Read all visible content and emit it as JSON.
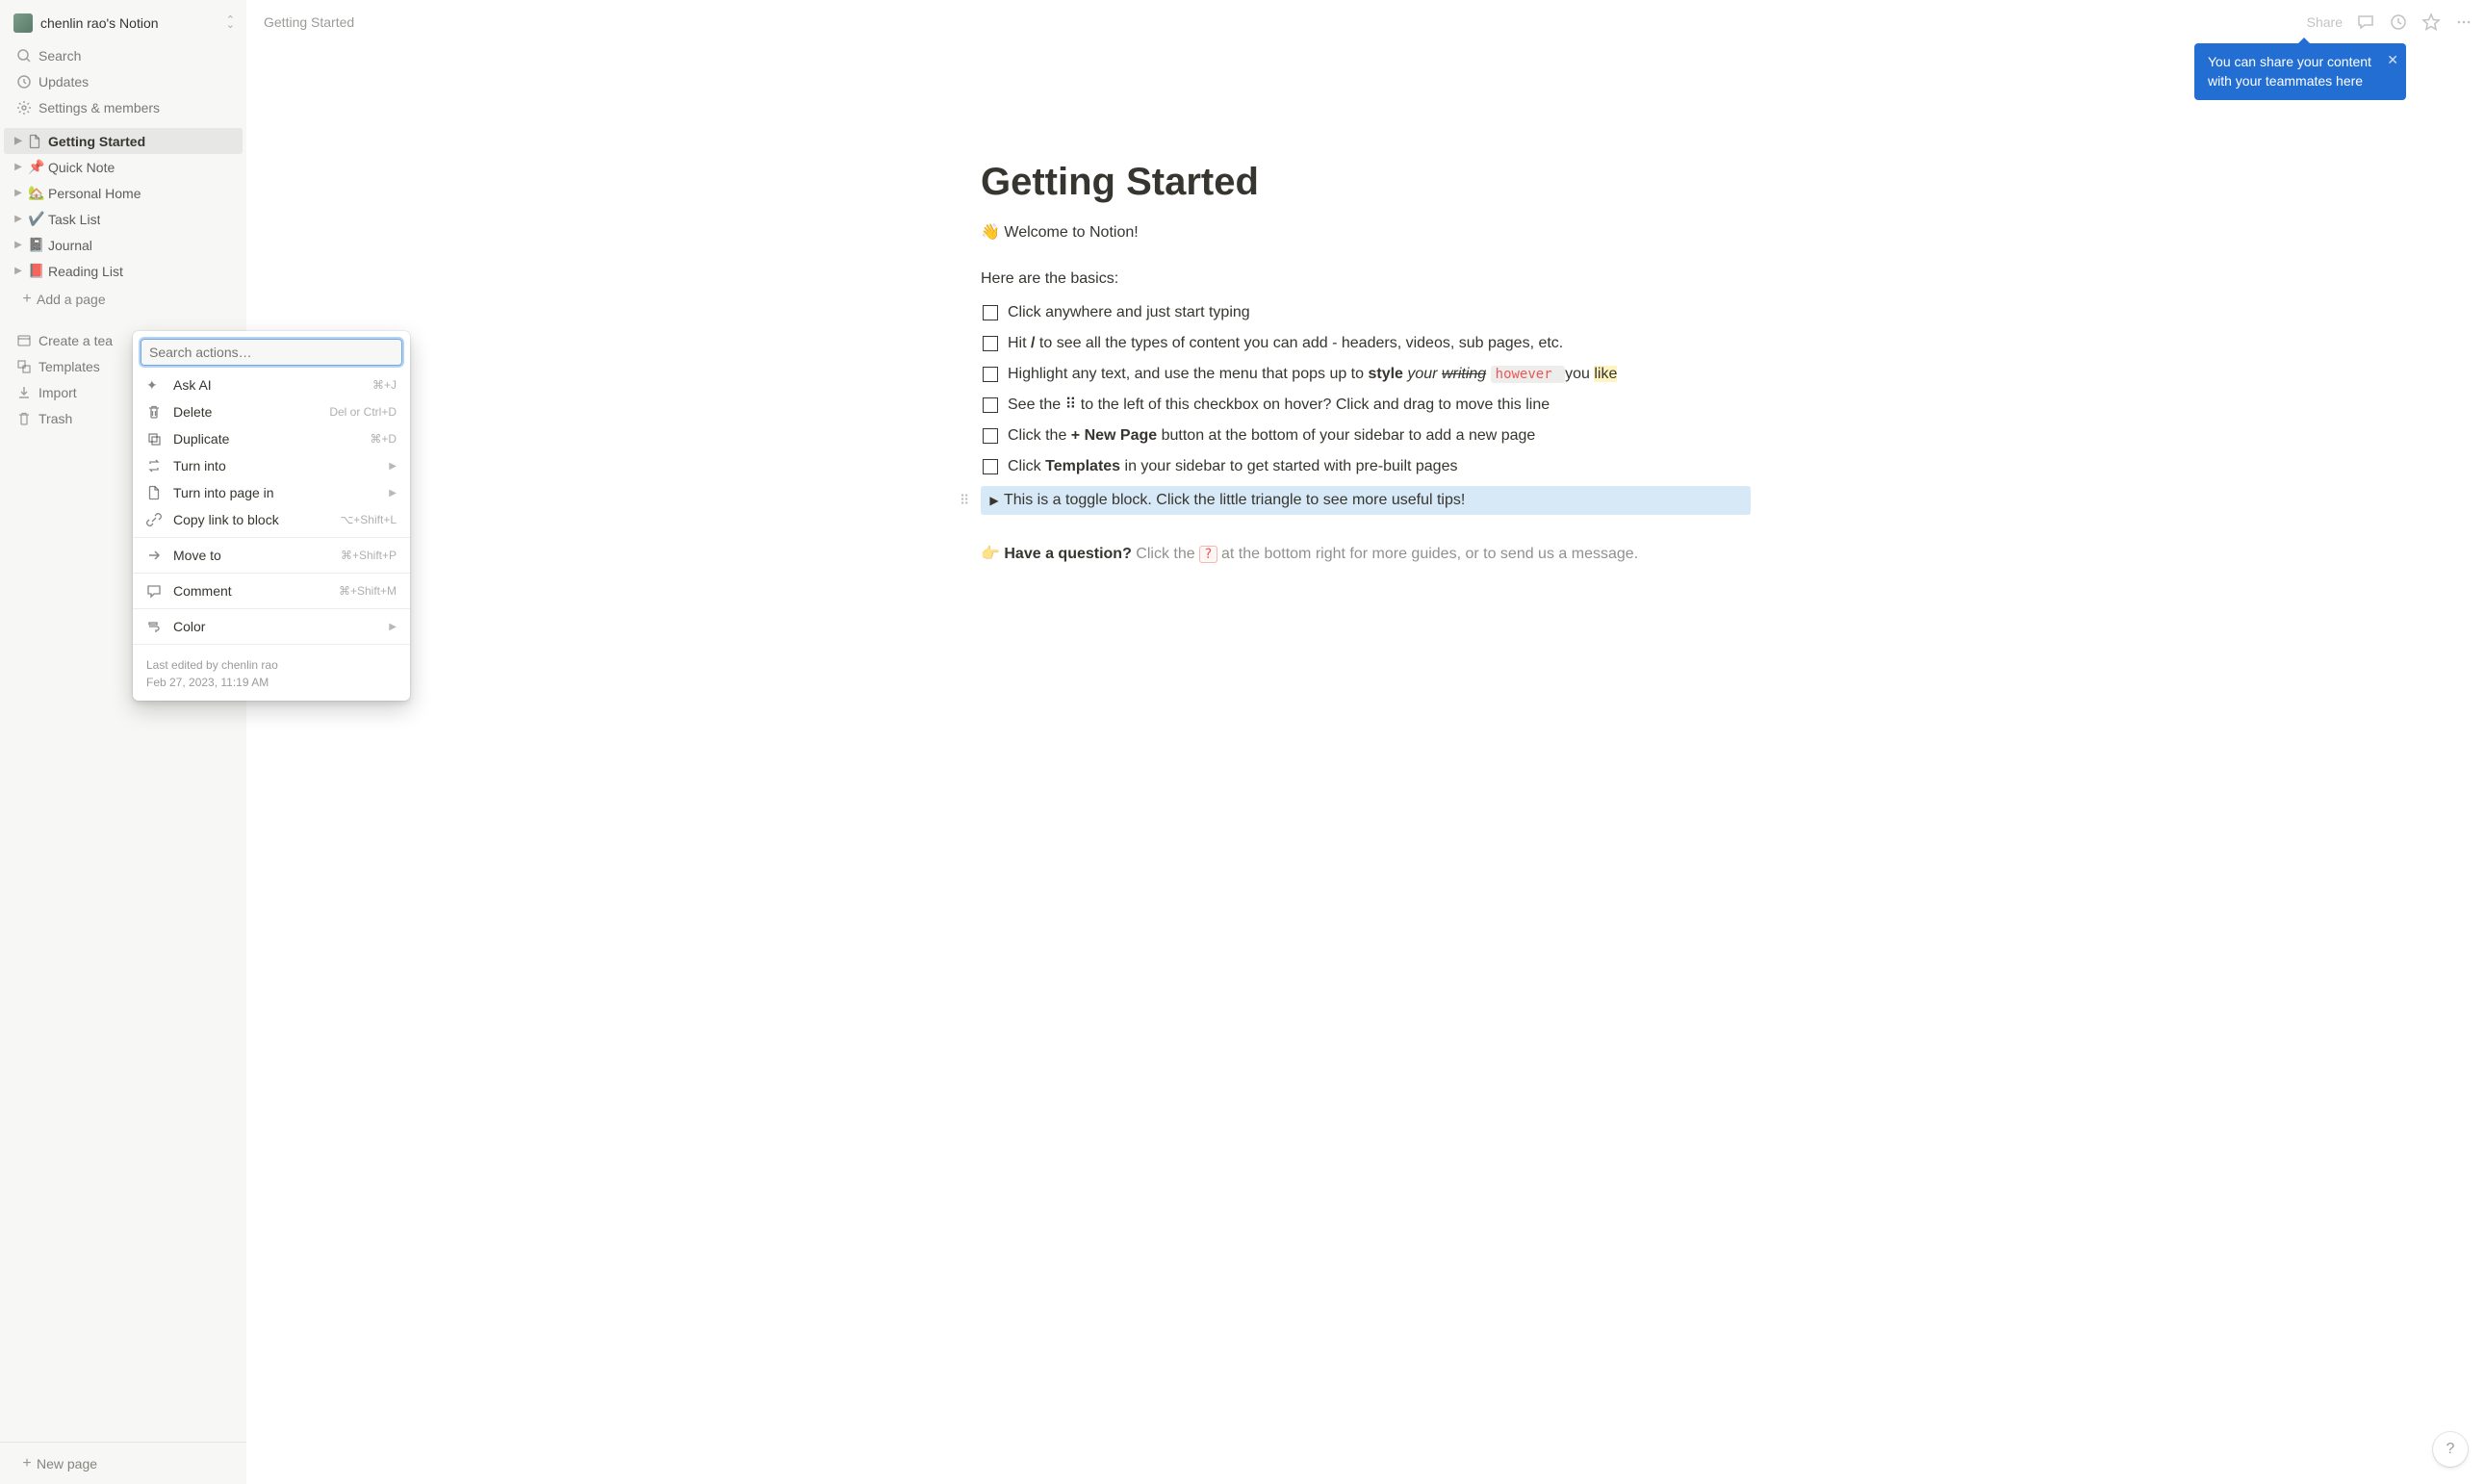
{
  "workspace": {
    "name": "chenlin rao's Notion"
  },
  "sidebar": {
    "search": "Search",
    "updates": "Updates",
    "settings": "Settings & members",
    "pages": [
      {
        "emoji": "📄",
        "label": "Getting Started",
        "active": true,
        "isDoc": true
      },
      {
        "emoji": "📌",
        "label": "Quick Note"
      },
      {
        "emoji": "🏡",
        "label": "Personal Home"
      },
      {
        "emoji": "✔️",
        "label": "Task List"
      },
      {
        "emoji": "📓",
        "label": "Journal"
      },
      {
        "emoji": "📕",
        "label": "Reading List"
      }
    ],
    "addPage": "Add a page",
    "createTeam": "Create a tea",
    "templates": "Templates",
    "import": "Import",
    "trash": "Trash",
    "newPage": "New page"
  },
  "topbar": {
    "breadcrumb": "Getting Started",
    "share": "Share"
  },
  "tooltip": {
    "text": "You can share your content with your teammates here"
  },
  "page": {
    "title": "Getting Started",
    "welcome": "Welcome to Notion!",
    "basics": "Here are the basics:",
    "todos": {
      "t0": "Click anywhere and just start typing",
      "t1a": "Hit ",
      "t1b": "/",
      "t1c": " to see all the types of content you can add - headers, videos, sub pages, etc.",
      "t2a": "Highlight any text, and use the menu that pops up to ",
      "t2b": "style",
      "t2c": " your ",
      "t2d": "writing",
      "t2e": " however ",
      "t2f": " you ",
      "t2g": "like",
      "t3a": "See the ",
      "t3b": " to the left of this checkbox on hover? Click and drag to move this line",
      "t4a": "Click the ",
      "t4b": "+ New Page",
      "t4c": " button at the bottom of your sidebar to add a new page",
      "t5a": "Click ",
      "t5b": "Templates",
      "t5c": " in your sidebar to get started with pre-built pages"
    },
    "toggle": "This is a toggle block. Click the little triangle to see more useful tips!",
    "questionA": "Have a question?",
    "questionB": " Click the ",
    "questionC": "?",
    "questionD": " at the bottom right for more guides, or to send us a message."
  },
  "menu": {
    "searchPlaceholder": "Search actions…",
    "items": [
      {
        "icon": "sparkle",
        "label": "Ask AI",
        "shortcut": "⌘+J"
      },
      {
        "icon": "trash",
        "label": "Delete",
        "shortcut": "Del or Ctrl+D"
      },
      {
        "icon": "duplicate",
        "label": "Duplicate",
        "shortcut": "⌘+D"
      },
      {
        "icon": "turninto",
        "label": "Turn into",
        "submenu": true
      },
      {
        "icon": "page",
        "label": "Turn into page in",
        "submenu": true
      },
      {
        "icon": "link",
        "label": "Copy link to block",
        "shortcut": "⌥+Shift+L"
      }
    ],
    "items2": [
      {
        "icon": "arrow",
        "label": "Move to",
        "shortcut": "⌘+Shift+P"
      }
    ],
    "items3": [
      {
        "icon": "comment",
        "label": "Comment",
        "shortcut": "⌘+Shift+M"
      }
    ],
    "items4": [
      {
        "icon": "paint",
        "label": "Color",
        "submenu": true
      }
    ],
    "footer1": "Last edited by chenlin rao",
    "footer2": "Feb 27, 2023, 11:19 AM"
  }
}
